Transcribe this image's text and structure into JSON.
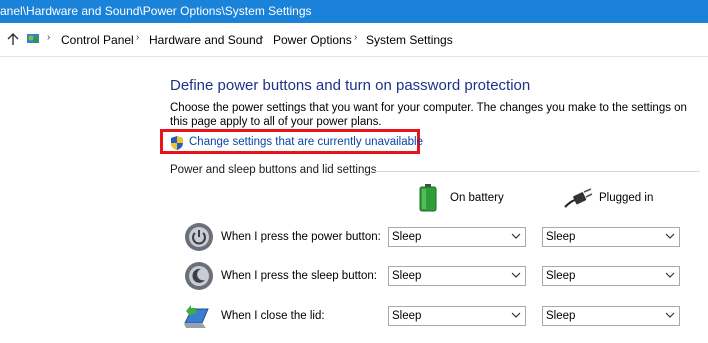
{
  "window": {
    "title": "anel\\Hardware and Sound\\Power Options\\System Settings"
  },
  "breadcrumb": {
    "items": [
      "Control Panel",
      "Hardware and Sound",
      "Power Options",
      "System Settings"
    ]
  },
  "page": {
    "heading": "Define power buttons and turn on password protection",
    "description": "Choose the power settings that you want for your computer. The changes you make to the settings on this page apply to all of your power plans.",
    "change_link": "Change settings that are currently unavailable",
    "section_label": "Power and sleep buttons and lid settings",
    "columns": {
      "battery": "On battery",
      "plugged": "Plugged in"
    },
    "rows": [
      {
        "label": "When I press the power button:",
        "battery": "Sleep",
        "plugged": "Sleep"
      },
      {
        "label": "When I press the sleep button:",
        "battery": "Sleep",
        "plugged": "Sleep"
      },
      {
        "label": "When I close the lid:",
        "battery": "Sleep",
        "plugged": "Sleep"
      }
    ]
  },
  "colors": {
    "titlebar": "#1a82d8",
    "heading": "#1e3287",
    "link": "#0645ad",
    "highlight": "#e8141b"
  },
  "icons": [
    "up-arrow-icon",
    "control-panel-icon",
    "shield-icon",
    "battery-icon",
    "plug-icon",
    "power-button-icon",
    "sleep-button-icon",
    "laptop-lid-icon",
    "chevron-down-icon"
  ]
}
